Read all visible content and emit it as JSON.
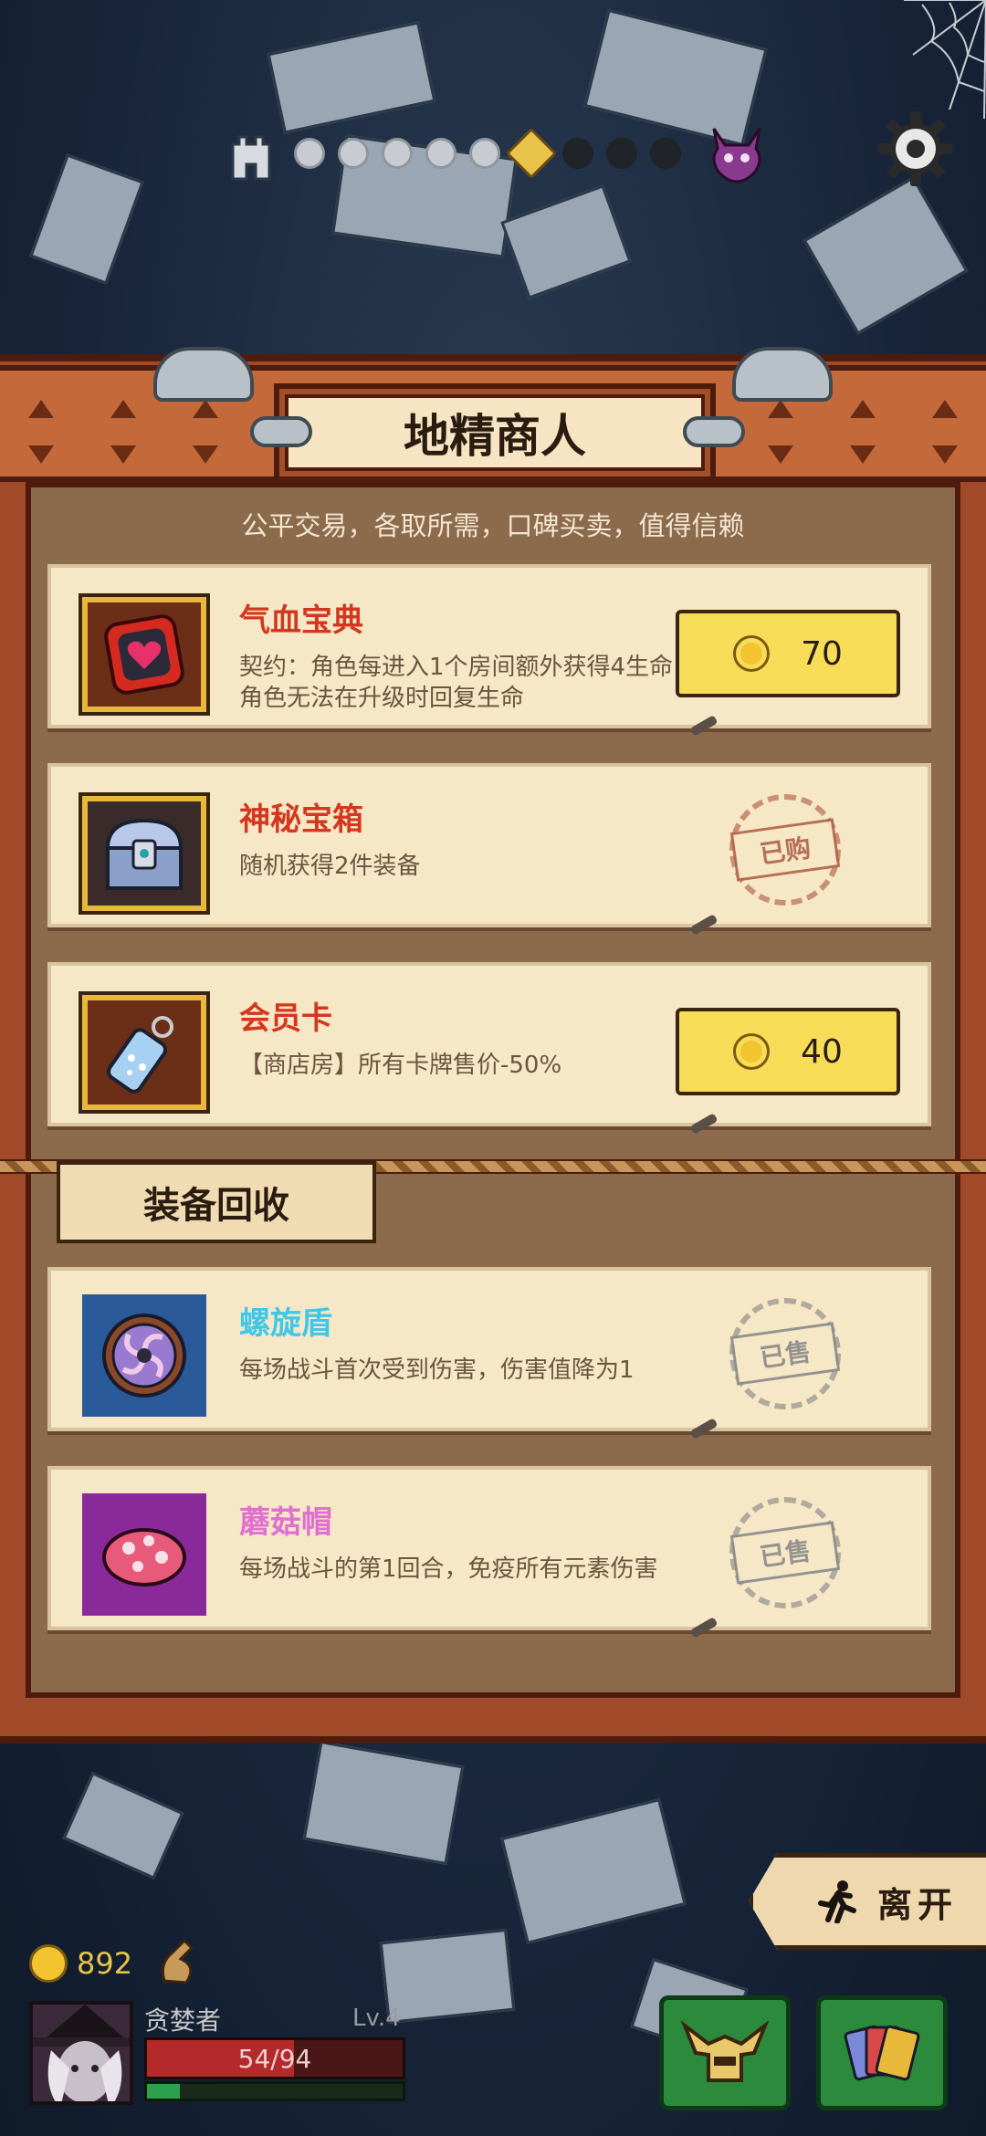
{
  "progress": {
    "stages": [
      "done",
      "done",
      "done",
      "done",
      "done",
      "current",
      "dark",
      "dark",
      "dark"
    ]
  },
  "shop": {
    "title": "地精商人",
    "subtitle": "公平交易，各取所需，口碑买卖，值得信赖",
    "items": [
      {
        "name": "气血宝典",
        "name_color": "#d4361e",
        "desc": "契约：角色每进入1个房间额外获得4生命；角色无法在升级时回复生命",
        "price": "70",
        "status": "buy",
        "icon": "heart-tome-icon"
      },
      {
        "name": "神秘宝箱",
        "name_color": "#d4361e",
        "desc": "随机获得2件装备",
        "stamp": "已购",
        "status": "bought",
        "icon": "treasure-chest-icon"
      },
      {
        "name": "会员卡",
        "name_color": "#d4361e",
        "desc": "【商店房】所有卡牌售价-50%",
        "price": "40",
        "status": "buy",
        "icon": "member-card-icon"
      }
    ]
  },
  "recycle": {
    "title": "装备回收",
    "items": [
      {
        "name": "螺旋盾",
        "name_color": "#3ec8e8",
        "desc": "每场战斗首次受到伤害，伤害值降为1",
        "stamp": "已售",
        "icon": "spiral-shield-icon"
      },
      {
        "name": "蘑菇帽",
        "name_color": "#e070d0",
        "desc": "每场战斗的第1回合，免疫所有元素伤害",
        "stamp": "已售",
        "icon": "mushroom-hat-icon"
      }
    ]
  },
  "leave_label": "离开",
  "player": {
    "gold": "892",
    "name": "贪婪者",
    "level": "Lv.4",
    "hp_text": "54/94",
    "hp_fraction": 0.574,
    "xp_fraction": 0.13
  },
  "colors": {
    "accent_gold": "#f7dc58",
    "wood": "#a04a2a",
    "parchment": "#f6e7c6"
  }
}
